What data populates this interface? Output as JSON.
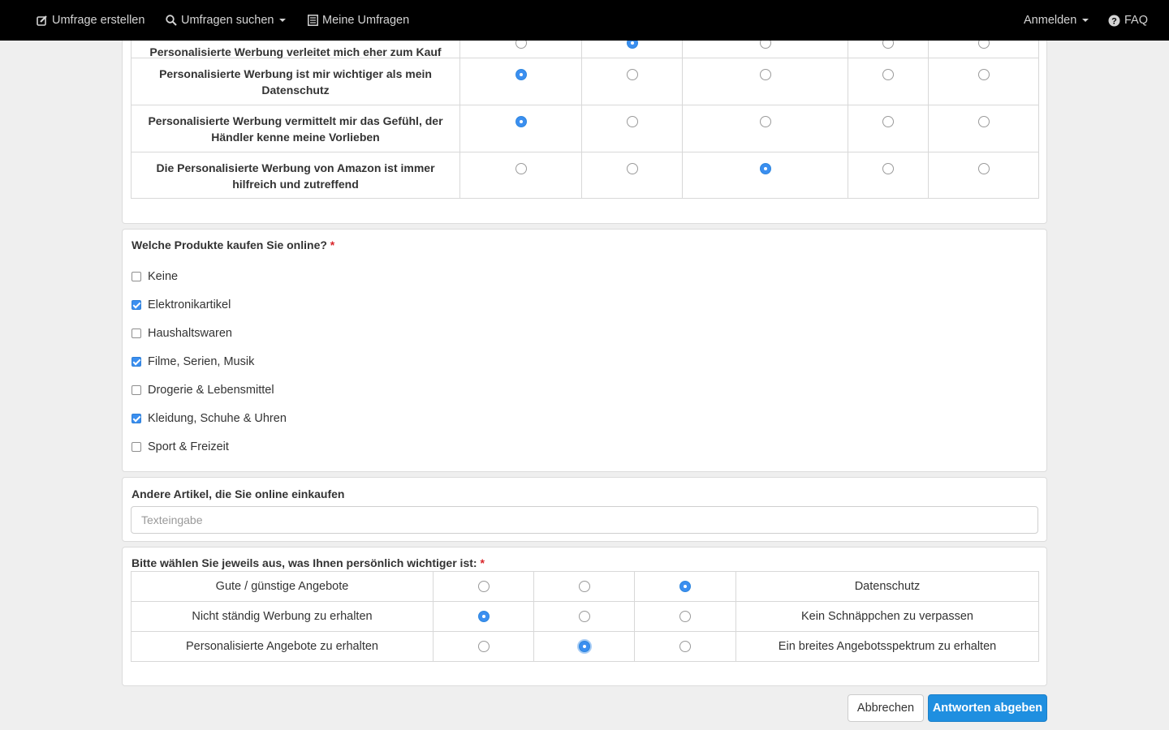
{
  "nav": {
    "create": "Umfrage erstellen",
    "search": "Umfragen suchen",
    "mine": "Meine Umfragen",
    "login": "Anmelden",
    "faq": "FAQ"
  },
  "matrix": {
    "rows": [
      {
        "label": "Personalisierte Werbung verleitet mich eher zum Kauf",
        "selected": 1
      },
      {
        "label": "Personalisierte Werbung ist mir wichtiger als mein Datenschutz",
        "selected": 0
      },
      {
        "label": "Personalisierte Werbung vermittelt mir das Gefühl, der Händler kenne meine Vorlieben",
        "selected": 0
      },
      {
        "label": "Die Personalisierte Werbung von Amazon ist immer hilfreich und zutreffend",
        "selected": 2
      }
    ]
  },
  "products": {
    "question": "Welche Produkte kaufen Sie online?",
    "required_mark": "*",
    "options": [
      {
        "label": "Keine",
        "checked": false
      },
      {
        "label": "Elektronikartikel",
        "checked": true
      },
      {
        "label": "Haushaltswaren",
        "checked": false
      },
      {
        "label": "Filme, Serien, Musik",
        "checked": true
      },
      {
        "label": "Drogerie & Lebensmittel",
        "checked": false
      },
      {
        "label": "Kleidung, Schuhe & Uhren",
        "checked": true
      },
      {
        "label": "Sport & Freizeit",
        "checked": false
      }
    ]
  },
  "other": {
    "question": "Andere Artikel, die Sie online einkaufen",
    "placeholder": "Texteingabe",
    "value": ""
  },
  "choice": {
    "question": "Bitte wählen Sie jeweils aus, was Ihnen persönlich wichtiger ist:",
    "required_mark": "*",
    "rows": [
      {
        "left": "Gute / günstige Angebote",
        "right": "Datenschutz",
        "selected": 2
      },
      {
        "left": "Nicht ständig Werbung zu erhalten",
        "right": "Kein Schnäppchen zu verpassen",
        "selected": 0
      },
      {
        "left": "Personalisierte Angebote zu erhalten",
        "right": "Ein breites Angebotsspektrum zu erhalten",
        "selected": 1
      }
    ]
  },
  "actions": {
    "cancel": "Abbrechen",
    "submit": "Antworten abgeben"
  },
  "colors": {
    "navbar": "#000000",
    "accent": "#3b8ff0",
    "primary_button": "#1f8fe0",
    "required": "#d9262b"
  }
}
